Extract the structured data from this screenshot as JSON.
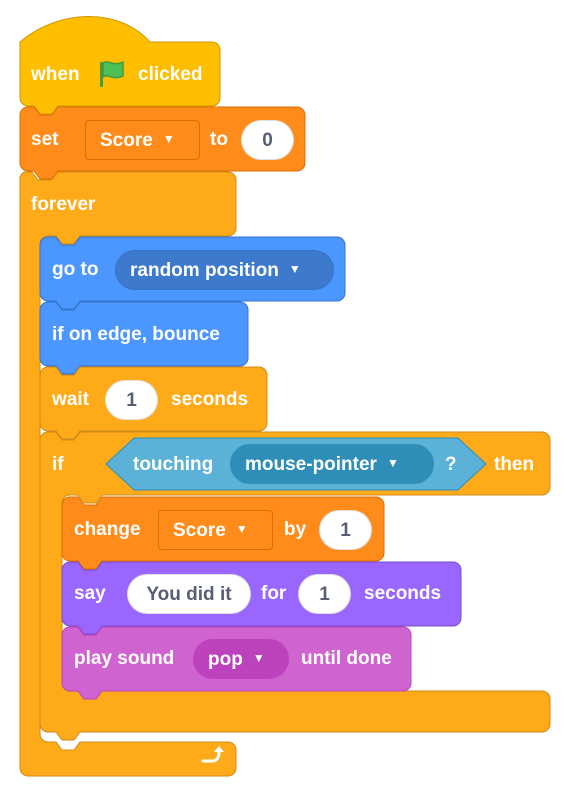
{
  "colors": {
    "events": "#ffbf00",
    "variables": "#ff8c1a",
    "control": "#ffab19",
    "motion": "#4c97ff",
    "sensing": "#5cb1d6",
    "looks": "#9966ff",
    "sound": "#cf63cf"
  },
  "hat": {
    "when": "when",
    "flag_icon": "green-flag-icon",
    "clicked": "clicked"
  },
  "set_block": {
    "set": "set",
    "variable": "Score",
    "to": "to",
    "value": "0"
  },
  "forever_block": {
    "label": "forever",
    "loop_icon": "loop-arrow-icon"
  },
  "goto_block": {
    "label": "go to",
    "target": "random position"
  },
  "bounce_block": {
    "label": "if on edge, bounce"
  },
  "wait_block": {
    "wait": "wait",
    "value": "1",
    "seconds": "seconds"
  },
  "if_block": {
    "if": "if",
    "touching": "touching",
    "object": "mouse-pointer",
    "question": "?",
    "then": "then"
  },
  "change_block": {
    "change": "change",
    "variable": "Score",
    "by": "by",
    "value": "1"
  },
  "say_block": {
    "say": "say",
    "message": "You did it",
    "for": "for",
    "value": "1",
    "seconds": "seconds"
  },
  "sound_block": {
    "play_sound": "play sound",
    "sound": "pop",
    "until_done": "until done"
  }
}
